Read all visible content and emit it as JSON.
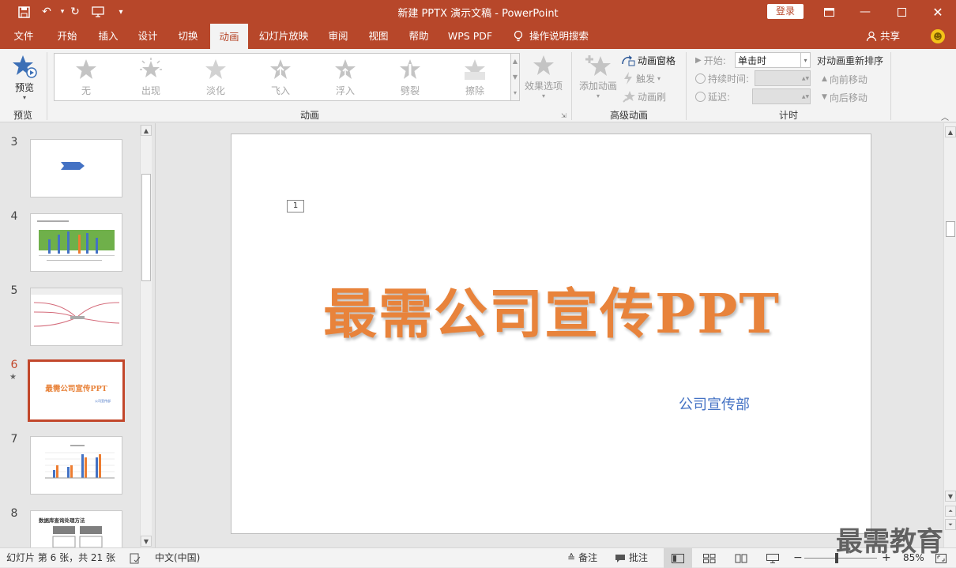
{
  "titlebar": {
    "title": "新建 PPTX 演示文稿 - PowerPoint",
    "login_label": "登录"
  },
  "menu": {
    "tabs": [
      "文件",
      "开始",
      "插入",
      "设计",
      "切换",
      "动画",
      "幻灯片放映",
      "审阅",
      "视图",
      "帮助",
      "WPS PDF"
    ],
    "active_tab": "动画",
    "search_label": "操作说明搜索",
    "share_label": "共享"
  },
  "ribbon": {
    "preview": {
      "label": "预览",
      "group": "预览"
    },
    "animation_group": {
      "group": "动画",
      "effects": [
        "无",
        "出现",
        "淡化",
        "飞入",
        "浮入",
        "劈裂",
        "擦除"
      ],
      "effect_options": "效果选项"
    },
    "advanced": {
      "group": "高级动画",
      "add_animation": "添加动画",
      "animation_pane": "动画窗格",
      "trigger": "触发",
      "painter": "动画刷"
    },
    "timing": {
      "group": "计时",
      "start_label": "开始:",
      "start_value": "单击时",
      "duration_label": "持续时间:",
      "delay_label": "延迟:",
      "reorder_title": "对动画重新排序",
      "move_earlier": "向前移动",
      "move_later": "向后移动"
    }
  },
  "thumbnails": {
    "numbers": [
      "3",
      "4",
      "5",
      "6",
      "7",
      "8"
    ],
    "selected": "6",
    "thumb6_title": "最需公司宣传PPT",
    "thumb6_sub": "公司宣传部",
    "thumb8_title": "数据库查询处理方法"
  },
  "slide": {
    "anim_tag": "1",
    "title": "最需公司宣传PPT",
    "subtitle": "公司宣传部"
  },
  "status": {
    "slide_info": "幻灯片 第 6 张，共 21 张",
    "language": "中文(中国)",
    "notes": "备注",
    "comments": "批注",
    "zoom": "85%"
  },
  "watermark": "最需教育",
  "colors": {
    "accent": "#b7472a",
    "title_text": "#e8833b",
    "subtitle_text": "#4472c4"
  }
}
